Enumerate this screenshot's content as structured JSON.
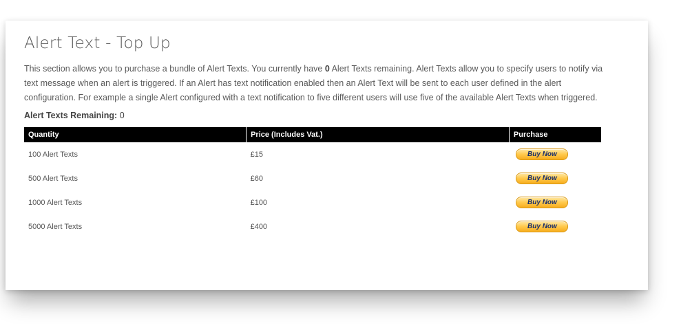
{
  "page": {
    "title": "Alert Text - Top Up",
    "description_part1": "This section allows you to purchase a bundle of Alert Texts. You currently have ",
    "description_count": "0",
    "description_part2": " Alert Texts remaining. Alert Texts allow you to specify users to notify via text message when an alert is triggered. If an Alert has text notification enabled then an Alert Text will be sent to each user defined in the alert configuration. For example a single Alert configured with a text notification to five different users will use five of the available Alert Texts when triggered.",
    "remaining_label": "Alert Texts Remaining:",
    "remaining_value": "0"
  },
  "table": {
    "headers": {
      "quantity": "Quantity",
      "price": "Price (Includes Vat.)",
      "purchase": "Purchase"
    },
    "rows": [
      {
        "quantity": "100 Alert Texts",
        "price": "£15",
        "button": "Buy Now"
      },
      {
        "quantity": "500 Alert Texts",
        "price": "£60",
        "button": "Buy Now"
      },
      {
        "quantity": "1000 Alert Texts",
        "price": "£100",
        "button": "Buy Now"
      },
      {
        "quantity": "5000 Alert Texts",
        "price": "£400",
        "button": "Buy Now"
      }
    ]
  },
  "colors": {
    "header_bg": "#000000",
    "button_gold": "#ffc94c",
    "button_text": "#1a2f6b"
  }
}
